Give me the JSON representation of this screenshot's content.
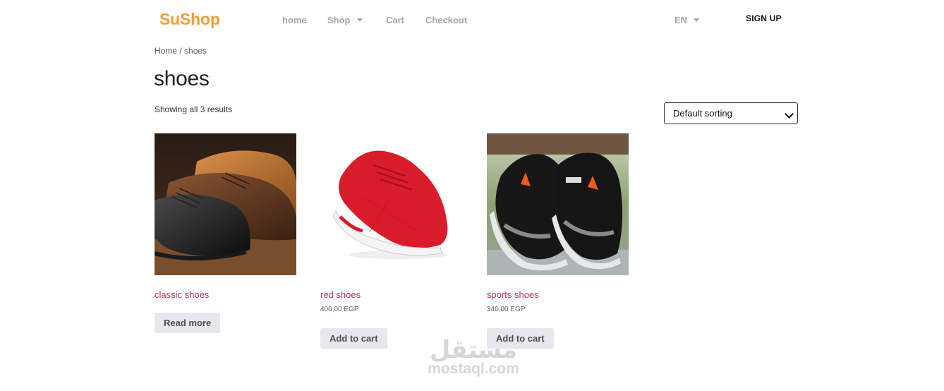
{
  "header": {
    "brand": "SuShop",
    "nav": [
      {
        "label": "home"
      },
      {
        "label": "Shop",
        "has_dropdown": true
      },
      {
        "label": "Cart"
      },
      {
        "label": "Checkout"
      }
    ],
    "language": "EN",
    "signup_label": "SIGN UP"
  },
  "breadcrumb": {
    "home": "Home",
    "separator": " / ",
    "current": "shoes"
  },
  "page": {
    "title": "shoes",
    "result_count": "Showing all 3 results",
    "sorting": {
      "selected": "Default sorting"
    }
  },
  "products": [
    {
      "title": "classic shoes",
      "price": "",
      "button": "Read more",
      "image": "classic-leather-brogue-shoes"
    },
    {
      "title": "red shoes",
      "price": "400,00 EGP",
      "button": "Add to cart",
      "image": "red-sneakers"
    },
    {
      "title": "sports shoes",
      "price": "340,00 EGP",
      "button": "Add to cart",
      "image": "black-sports-sneakers"
    }
  ],
  "watermark": {
    "arabic": "مستقل",
    "latin": "mostaql.com"
  },
  "colors": {
    "brand": "#f39c38",
    "product_link": "#c22d5b",
    "button_bg": "#e9e6ed",
    "nav": "#a6a6a6"
  }
}
